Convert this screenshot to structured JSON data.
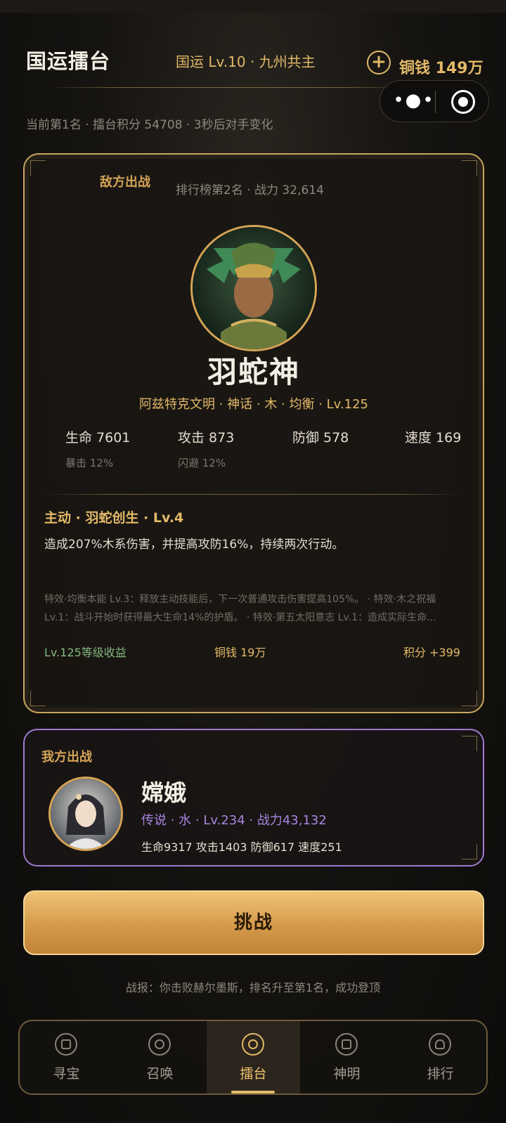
{
  "header": {
    "title": "国运擂台",
    "nation_level": "国运 Lv.10 · 九州共主",
    "coins": "铜钱 149万",
    "add_coin_icon": "plus-icon"
  },
  "capsule": {
    "more_icon": "more-dots-icon",
    "close_icon": "target-circle-icon"
  },
  "status": "当前第1名 · 擂台积分 54708 · 3秒后对手变化",
  "enemy": {
    "label": "敌方出战",
    "rank": "排行榜第2名 · 战力 32,614",
    "name": "羽蛇神",
    "sub": "阿兹特克文明 · 神话 · 木 · 均衡 · Lv.125",
    "stats": {
      "hp": "生命 7601",
      "atk": "攻击 873",
      "def": "防御 578",
      "spd": "速度 169",
      "crit": "暴击 12%",
      "dodge": "闪避 12%"
    },
    "skill_title": "主动 · 羽蛇创生 · Lv.4",
    "skill_desc": "造成207%木系伤害，并提高攻防16%，持续两次行动。",
    "passives": "特效·均衡本能 Lv.3：释放主动技能后，下一次普通攻击伤害提高105%。 · 特效·木之祝福 Lv.1：战斗开始时获得最大生命14%的护盾。 · 特效·第五太阳意志 Lv.1：造成实际生命...",
    "reward_level": "Lv.125等级收益",
    "reward_coin": "铜钱 19万",
    "reward_score": "积分 +399"
  },
  "player": {
    "label": "我方出战",
    "name": "嫦娥",
    "sub": "传说 · 水 · Lv.234 · 战力43,132",
    "stats": "生命9317  攻击1403  防御617  速度251"
  },
  "challenge_label": "挑战",
  "battle_report": "战报：你击败赫尔墨斯，排名升至第1名，成功登顶",
  "nav": [
    {
      "label": "寻宝",
      "icon": "treasure-icon"
    },
    {
      "label": "召唤",
      "icon": "summon-icon"
    },
    {
      "label": "擂台",
      "icon": "arena-icon"
    },
    {
      "label": "神明",
      "icon": "gods-icon"
    },
    {
      "label": "排行",
      "icon": "ranking-icon"
    }
  ],
  "colors": {
    "gold": "#e2b968",
    "purple": "#a784e0",
    "green": "#83b87f"
  }
}
